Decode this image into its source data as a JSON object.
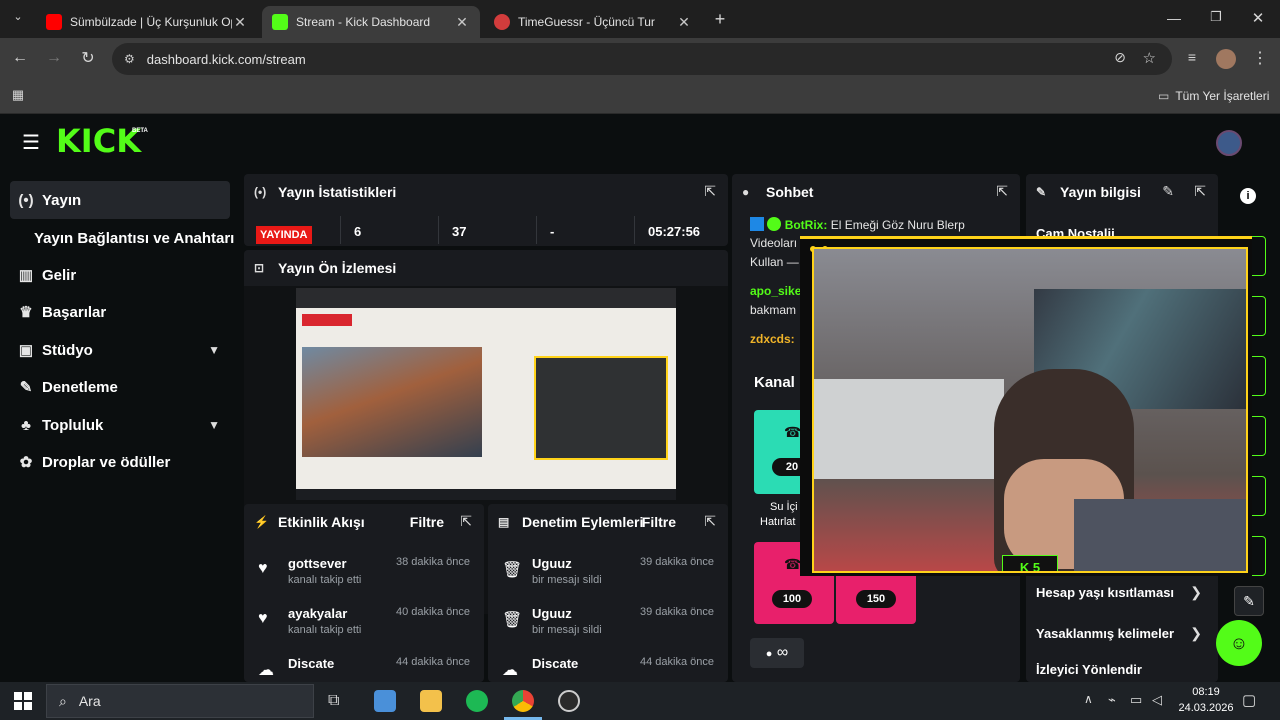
{
  "browser": {
    "tabs": [
      {
        "title": "Sümbülzade | Üç Kurşunluk Op",
        "close": "✕"
      },
      {
        "title": "Stream - Kick Dashboard",
        "close": "✕"
      },
      {
        "title": "TimeGuessr - Üçüncü Tur",
        "close": "✕"
      }
    ],
    "new_tab": "+",
    "url": "dashboard.kick.com/stream",
    "bookmarks_label": "Tüm Yer İşaretleri"
  },
  "kick": {
    "logo": "KICK",
    "logo_badge": "BETA",
    "nav": [
      {
        "label": "Yayın",
        "icon": "broadcast-icon"
      },
      {
        "label": "Yayın Bağlantısı ve Anahtarı"
      },
      {
        "label": "Gelir",
        "icon": "chart-icon"
      },
      {
        "label": "Başarılar",
        "icon": "trophy-icon"
      },
      {
        "label": "Stüdyo",
        "icon": "studio-icon"
      },
      {
        "label": "Denetleme",
        "icon": "wrench-icon"
      },
      {
        "label": "Topluluk",
        "icon": "community-icon"
      },
      {
        "label": "Droplar ve ödüller",
        "icon": "gift-icon"
      }
    ],
    "stats": {
      "title": "Yayın İstatistikleri",
      "live": "YAYINDA",
      "viewers": "6",
      "followers": "37",
      "other": "-",
      "duration": "05:27:56"
    },
    "preview": {
      "title": "Yayın Ön İzlemesi"
    },
    "activity": {
      "title": "Etkinlik Akışı",
      "filter": "Filtre",
      "items": [
        {
          "name": "gottsever",
          "sub": "kanalı takip etti",
          "time": "38 dakika önce"
        },
        {
          "name": "ayakyalar",
          "sub": "kanalı takip etti",
          "time": "40 dakika önce"
        },
        {
          "name": "Discate",
          "sub": "",
          "time": "44 dakika önce"
        }
      ]
    },
    "moderation": {
      "title": "Denetim Eylemleri",
      "filter": "Filtre",
      "items": [
        {
          "name": "Uguuz",
          "sub": "bir mesajı sildi",
          "time": "39 dakika önce"
        },
        {
          "name": "Uguuz",
          "sub": "bir mesajı sildi",
          "time": "39 dakika önce"
        },
        {
          "name": "Discate",
          "sub": "",
          "time": "44 dakika önce"
        }
      ]
    },
    "chat": {
      "title": "Sohbet",
      "bot_name": "BotRix:",
      "bot_msg": "El Emeği Göz Nuru Blerp",
      "bot_line2": "Videoları",
      "bot_line3": "Kullan —",
      "user1": "apo_sike",
      "user1_msg": "bakmam",
      "user2": "zdxcds:",
      "channel_label": "Kanal",
      "card1_value": "20",
      "card1_label": "Su İçi",
      "card1_label2": "Hatırlat",
      "card2_value": "100",
      "card3_value": "150",
      "infinity": "∞"
    },
    "info": {
      "title": "Yayın bilgisi",
      "subtitle": "Cam Nostalji",
      "items": [
        "Hesap yaşı kısıtlaması",
        "Yasaklanmış kelimeler",
        "İzleyici Yönlendir"
      ]
    },
    "overlay_badge": "5"
  },
  "taskbar": {
    "search": "Ara",
    "time": "08:19",
    "date": "24.03.2026"
  },
  "colors": {
    "kick_green": "#53fc18",
    "live_red": "#e91916",
    "panel_bg": "#191b1f",
    "overlay_yellow": "#ffd31a"
  }
}
